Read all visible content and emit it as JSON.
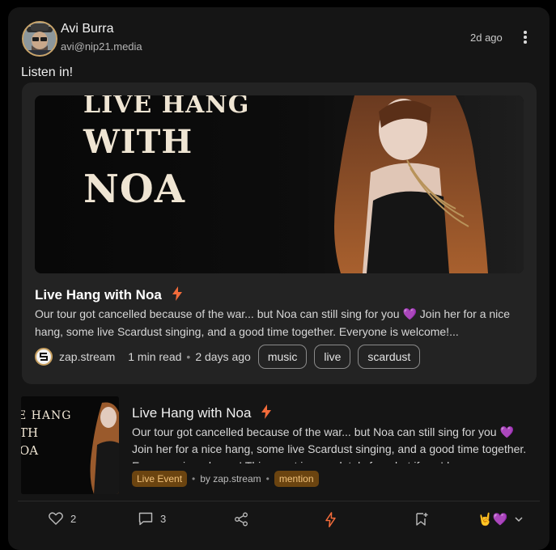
{
  "post": {
    "author_name": "Avi Burra",
    "author_handle": "avi@nip21.media",
    "time": "2d ago",
    "body": "Listen in!"
  },
  "embed": {
    "hero_text": [
      "LIVE HANG",
      "WITH",
      "NOA"
    ],
    "title": "Live Hang with Noa",
    "description": "Our tour got cancelled because of the war... but Noa can still sing for you 💜 Join her for a nice hang, some live Scardust singing, and a good time together. Everyone is welcome!...",
    "source": "zap.stream",
    "read_time": "1 min read",
    "age": "2 days ago",
    "tags": [
      "music",
      "live",
      "scardust"
    ]
  },
  "event": {
    "thumb_text": [
      "E HANG",
      "TH",
      "OA"
    ],
    "title": "Live Hang with Noa",
    "description": "Our tour got cancelled because of the war... but Noa can still sing for you 💜 Join her for a nice hang, some live Scardust singing, and a good time together. Everyone is welcome! This event is completely free, but if you'd",
    "badge": "Live Event",
    "by": "by zap.stream",
    "mention": "mention"
  },
  "actions": {
    "likes": "2",
    "comments": "3",
    "reactions": "🤘💜"
  },
  "colors": {
    "accent": "#f26b3a",
    "badge_bg": "#6b4410",
    "card_bg": "#151515"
  }
}
